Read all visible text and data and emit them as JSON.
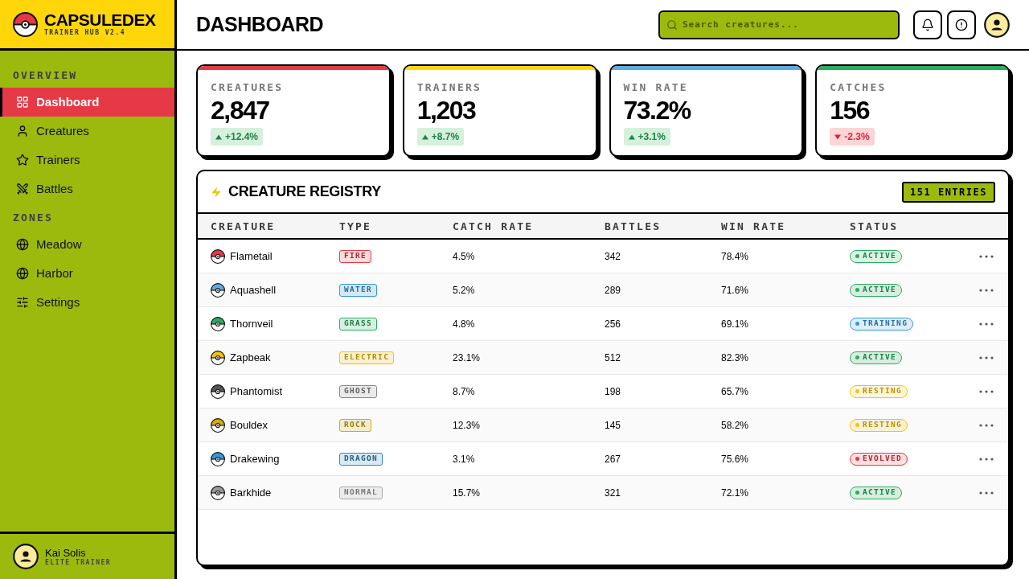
{
  "app": {
    "name": "CAPSULEDEX",
    "subtitle": "TRAINER HUB V2.4"
  },
  "sidebar": {
    "sections": [
      {
        "title": "OVERVIEW",
        "items": [
          {
            "label": "Dashboard",
            "selected": true
          },
          {
            "label": "Creatures",
            "selected": false
          },
          {
            "label": "Trainers",
            "selected": false
          },
          {
            "label": "Battles",
            "selected": false
          }
        ]
      },
      {
        "title": "ZONES",
        "items": [
          {
            "label": "Meadow",
            "selected": false
          },
          {
            "label": "Harbor",
            "selected": false
          },
          {
            "label": "Settings",
            "selected": false
          }
        ]
      }
    ],
    "user": {
      "name": "Kai Solis",
      "role": "ELITE TRAINER"
    }
  },
  "header": {
    "title": "DASHBOARD",
    "search": {
      "placeholder": "Search creatures..."
    }
  },
  "stats": [
    {
      "label": "CREATURES",
      "value": "2,847",
      "delta": "+12.4%",
      "trend_up": true,
      "color": "#e63946"
    },
    {
      "label": "TRAINERS",
      "value": "1,203",
      "delta": "+8.7%",
      "trend_up": true,
      "color": "#ffd60a"
    },
    {
      "label": "WIN RATE",
      "value": "73.2%",
      "delta": "+3.1%",
      "trend_up": true,
      "color": "#5dade2"
    },
    {
      "label": "CATCHES",
      "value": "156",
      "delta": "-2.3%",
      "trend_up": false,
      "color": "#27ae60"
    }
  ],
  "registry": {
    "title": "CREATURE REGISTRY",
    "count": "151 ENTRIES",
    "columns": [
      "CREATURE",
      "TYPE",
      "CATCH RATE",
      "BATTLES",
      "WIN RATE",
      "STATUS"
    ],
    "rows": [
      {
        "name": "Flametail",
        "color": "#e63946",
        "type": {
          "label": "FIRE",
          "color": "#e63946"
        },
        "catch_rate": "4.5%",
        "battles": "342",
        "win_rate": "78.4%",
        "status": {
          "label": "ACTIVE",
          "color": "#27ae60"
        }
      },
      {
        "name": "Aquashell",
        "color": "#5dade2",
        "type": {
          "label": "WATER",
          "color": "#3498db"
        },
        "catch_rate": "5.2%",
        "battles": "289",
        "win_rate": "71.6%",
        "status": {
          "label": "ACTIVE",
          "color": "#27ae60"
        }
      },
      {
        "name": "Thornveil",
        "color": "#27ae60",
        "type": {
          "label": "GRASS",
          "color": "#27ae60"
        },
        "catch_rate": "4.8%",
        "battles": "256",
        "win_rate": "69.1%",
        "status": {
          "label": "TRAINING",
          "color": "#3498db"
        }
      },
      {
        "name": "Zapbeak",
        "color": "#f1c40f",
        "type": {
          "label": "ELECTRIC",
          "color": "#f1c40f"
        },
        "catch_rate": "23.1%",
        "battles": "512",
        "win_rate": "82.3%",
        "status": {
          "label": "ACTIVE",
          "color": "#27ae60"
        }
      },
      {
        "name": "Phantomist",
        "color": "#555555",
        "type": {
          "label": "GHOST",
          "color": "#888888"
        },
        "catch_rate": "8.7%",
        "battles": "198",
        "win_rate": "65.7%",
        "status": {
          "label": "RESTING",
          "color": "#f1c40f"
        }
      },
      {
        "name": "Bouldex",
        "color": "#d4ac0d",
        "type": {
          "label": "ROCK",
          "color": "#d4ac0d"
        },
        "catch_rate": "12.3%",
        "battles": "145",
        "win_rate": "58.2%",
        "status": {
          "label": "RESTING",
          "color": "#f1c40f"
        }
      },
      {
        "name": "Drakewing",
        "color": "#3498db",
        "type": {
          "label": "DRAGON",
          "color": "#2e86c1"
        },
        "catch_rate": "3.1%",
        "battles": "267",
        "win_rate": "75.6%",
        "status": {
          "label": "EVOLVED",
          "color": "#e63946"
        }
      },
      {
        "name": "Barkhide",
        "color": "#999999",
        "type": {
          "label": "NORMAL",
          "color": "#aaaaaa"
        },
        "catch_rate": "15.7%",
        "battles": "321",
        "win_rate": "72.1%",
        "status": {
          "label": "ACTIVE",
          "color": "#27ae60"
        }
      }
    ]
  }
}
